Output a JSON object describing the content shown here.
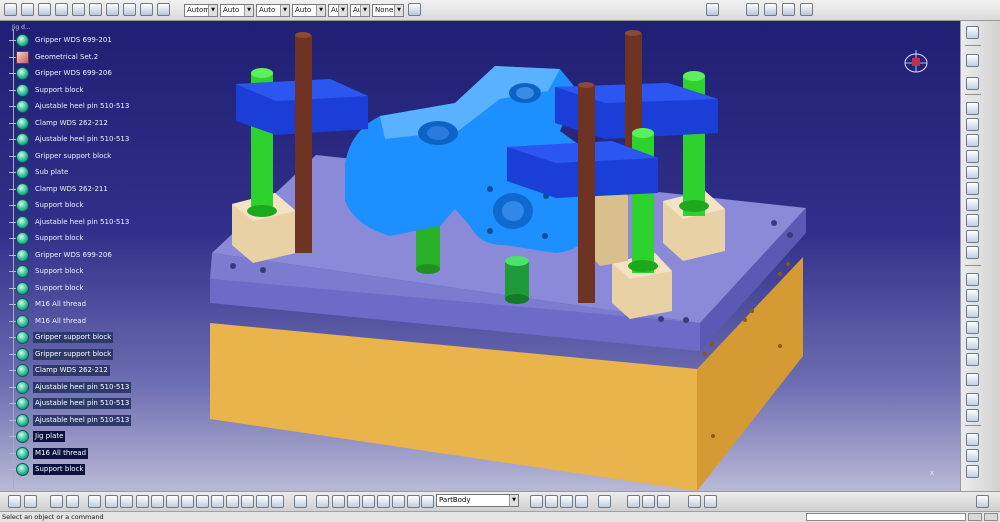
{
  "toolbar": {
    "dropdowns": [
      {
        "value": "Autom"
      },
      {
        "value": "Auto"
      },
      {
        "value": "Auto"
      },
      {
        "value": "Auto"
      },
      {
        "value": "Aut"
      },
      {
        "value": "Aut"
      },
      {
        "value": "None"
      }
    ]
  },
  "tree": {
    "root_label": "Jig d...",
    "items": [
      {
        "label": "Gripper WDS 699-201",
        "icon": "part",
        "hl": false
      },
      {
        "label": "Geometrical Set.2",
        "icon": "geometrical-set",
        "hl": false
      },
      {
        "label": "Gripper WDS 699-206",
        "icon": "part",
        "hl": false
      },
      {
        "label": "Support block",
        "icon": "part",
        "hl": false
      },
      {
        "label": "Ajustable heel pin 510-513",
        "icon": "part",
        "hl": false
      },
      {
        "label": "Clamp WDS 262-212",
        "icon": "part",
        "hl": false
      },
      {
        "label": "Ajustable heel pin 510-513",
        "icon": "part",
        "hl": false
      },
      {
        "label": "Gripper support block",
        "icon": "part",
        "hl": false
      },
      {
        "label": "Sub plate",
        "icon": "part",
        "hl": false
      },
      {
        "label": "Clamp WDS 262-211",
        "icon": "part",
        "hl": false
      },
      {
        "label": "Support block",
        "icon": "part",
        "hl": false
      },
      {
        "label": "Ajustable heel pin 510-513",
        "icon": "part",
        "hl": false
      },
      {
        "label": "Support block",
        "icon": "part",
        "hl": false
      },
      {
        "label": "Gripper WDS 699-206",
        "icon": "part",
        "hl": false
      },
      {
        "label": "Support block",
        "icon": "part",
        "hl": false
      },
      {
        "label": "Support block",
        "icon": "part",
        "hl": false
      },
      {
        "label": "M16 All thread",
        "icon": "part",
        "hl": false
      },
      {
        "label": "M16 All thread",
        "icon": "part",
        "hl": false
      },
      {
        "label": "Gripper support block",
        "icon": "part",
        "hl": true
      },
      {
        "label": "Gripper support block",
        "icon": "part",
        "hl": true
      },
      {
        "label": "Clamp WDS 262-212",
        "icon": "part",
        "hl": true
      },
      {
        "label": "Ajustable heel pin 510-513",
        "icon": "part",
        "hl": true
      },
      {
        "label": "Ajustable heel pin 510-513",
        "icon": "part",
        "hl": true
      },
      {
        "label": "Ajustable heel pin 510-513",
        "icon": "part",
        "hl": true
      },
      {
        "label": "Jig plate",
        "icon": "part",
        "hl": true
      },
      {
        "label": "M16 All thread",
        "icon": "part",
        "hl": true
      },
      {
        "label": "Support block",
        "icon": "part",
        "hl": true
      }
    ]
  },
  "viewport": {
    "axis_label": "x"
  },
  "bottom": {
    "part_select": "PartBody"
  },
  "status": {
    "message": "Select an object or a command"
  },
  "colors": {
    "base": "#e9b44c",
    "plate": "#7474d2",
    "clamp": "#1b3fd6",
    "workpiece": "#1e8fff",
    "pin": "#2ed22e",
    "rod": "#6e3322",
    "block": "#e8d1a5"
  }
}
